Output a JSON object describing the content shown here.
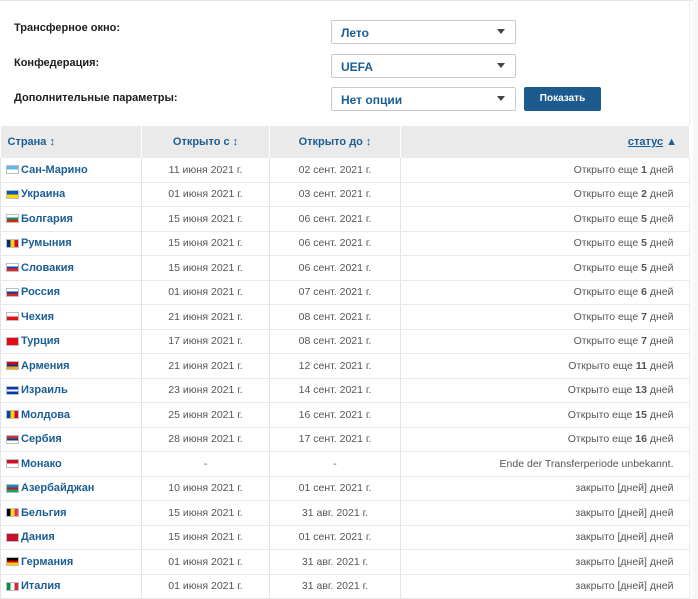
{
  "filters": {
    "transfer_window": {
      "label": "Трансферное окно:",
      "value": "Лето"
    },
    "confederation": {
      "label": "Конфедерация:",
      "value": "UEFA"
    },
    "extra": {
      "label": "Дополнительные параметры:",
      "value": "Нет опции"
    },
    "show_button": "Показать"
  },
  "table": {
    "headers": {
      "country": "Страна",
      "open_from": "Открыто с",
      "open_to": "Открыто до",
      "status": "статус"
    },
    "sort_icons": {
      "country": "↕",
      "open_from": "↕",
      "open_to": "↕",
      "status": "▲"
    },
    "rows": [
      {
        "country": "Сан-Марино",
        "flag": [
          "#5eb6e4",
          "#ffffff"
        ],
        "from": "11 июня 2021 г.",
        "to": "02 сент. 2021 г.",
        "status_pre": "Открыто еще ",
        "status_num": "1",
        "status_post": " дней",
        "state": "open"
      },
      {
        "country": "Украина",
        "flag": [
          "#0057b7",
          "#ffd700"
        ],
        "from": "01 июня 2021 г.",
        "to": "03 сент. 2021 г.",
        "status_pre": "Открыто еще ",
        "status_num": "2",
        "status_post": " дней",
        "state": "open"
      },
      {
        "country": "Болгария",
        "flag": [
          "#ffffff",
          "#00966e",
          "#d62612"
        ],
        "from": "15 июня 2021 г.",
        "to": "06 сент. 2021 г.",
        "status_pre": "Открыто еще ",
        "status_num": "5",
        "status_post": " дней",
        "state": "open"
      },
      {
        "country": "Румыния",
        "flag": [
          "#002b7f",
          "#fcd116",
          "#ce1126"
        ],
        "vertical": true,
        "from": "15 июня 2021 г.",
        "to": "06 сент. 2021 г.",
        "status_pre": "Открыто еще ",
        "status_num": "5",
        "status_post": " дней",
        "state": "open"
      },
      {
        "country": "Словакия",
        "flag": [
          "#ffffff",
          "#0b4ea2",
          "#ee1c25"
        ],
        "from": "15 июня 2021 г.",
        "to": "06 сент. 2021 г.",
        "status_pre": "Открыто еще ",
        "status_num": "5",
        "status_post": " дней",
        "state": "open"
      },
      {
        "country": "Россия",
        "flag": [
          "#ffffff",
          "#0039a6",
          "#d52b1e"
        ],
        "from": "01 июня 2021 г.",
        "to": "07 сент. 2021 г.",
        "status_pre": "Открыто еще ",
        "status_num": "6",
        "status_post": " дней",
        "state": "open"
      },
      {
        "country": "Чехия",
        "flag": [
          "#ffffff",
          "#d7141a"
        ],
        "from": "21 июня 2021 г.",
        "to": "08 сент. 2021 г.",
        "status_pre": "Открыто еще ",
        "status_num": "7",
        "status_post": " дней",
        "state": "open"
      },
      {
        "country": "Турция",
        "flag": [
          "#e30a17"
        ],
        "from": "17 июня 2021 г.",
        "to": "08 сент. 2021 г.",
        "status_pre": "Открыто еще ",
        "status_num": "7",
        "status_post": " дней",
        "state": "open"
      },
      {
        "country": "Армения",
        "flag": [
          "#d90012",
          "#0033a0",
          "#f2a800"
        ],
        "from": "21 июня 2021 г.",
        "to": "12 сент. 2021 г.",
        "status_pre": "Открыто еще ",
        "status_num": "11",
        "status_post": " дней",
        "state": "open"
      },
      {
        "country": "Израиль",
        "flag": [
          "#0038b8",
          "#ffffff",
          "#0038b8"
        ],
        "from": "23 июня 2021 г.",
        "to": "14 сент. 2021 г.",
        "status_pre": "Открыто еще ",
        "status_num": "13",
        "status_post": " дней",
        "state": "open"
      },
      {
        "country": "Молдова",
        "flag": [
          "#0046ae",
          "#ffd200",
          "#cc092f"
        ],
        "vertical": true,
        "from": "25 июня 2021 г.",
        "to": "16 сент. 2021 г.",
        "status_pre": "Открыто еще ",
        "status_num": "15",
        "status_post": " дней",
        "state": "open"
      },
      {
        "country": "Сербия",
        "flag": [
          "#c6363c",
          "#0c4076",
          "#ffffff"
        ],
        "from": "28 июня 2021 г.",
        "to": "17 сент. 2021 г.",
        "status_pre": "Открыто еще ",
        "status_num": "16",
        "status_post": " дней",
        "state": "open"
      },
      {
        "country": "Монако",
        "flag": [
          "#ce1126",
          "#ffffff"
        ],
        "from": "-",
        "to": "-",
        "status_pre": "Ende der Transferperiode unbekannt.",
        "status_num": "",
        "status_post": "",
        "state": "open"
      },
      {
        "country": "Азербайджан",
        "flag": [
          "#0092bc",
          "#e4002b",
          "#00af66"
        ],
        "from": "10 июня 2021 г.",
        "to": "01 сент. 2021 г.",
        "status_pre": "закрыто [дней] дней",
        "status_num": "",
        "status_post": "",
        "state": "closed"
      },
      {
        "country": "Бельгия",
        "flag": [
          "#000000",
          "#fdda24",
          "#ef3340"
        ],
        "vertical": true,
        "from": "15 июня 2021 г.",
        "to": "31 авг. 2021 г.",
        "status_pre": "закрыто [дней] дней",
        "status_num": "",
        "status_post": "",
        "state": "closed"
      },
      {
        "country": "Дания",
        "flag": [
          "#c8102e"
        ],
        "from": "15 июня 2021 г.",
        "to": "01 сент. 2021 г.",
        "status_pre": "закрыто [дней] дней",
        "status_num": "",
        "status_post": "",
        "state": "closed"
      },
      {
        "country": "Германия",
        "flag": [
          "#000000",
          "#dd0000",
          "#ffce00"
        ],
        "from": "01 июня 2021 г.",
        "to": "31 авг. 2021 г.",
        "status_pre": "закрыто [дней] дней",
        "status_num": "",
        "status_post": "",
        "state": "closed"
      },
      {
        "country": "Италия",
        "flag": [
          "#009246",
          "#ffffff",
          "#ce2b37"
        ],
        "vertical": true,
        "from": "01 июня 2021 г.",
        "to": "31 авг. 2021 г.",
        "status_pre": "закрыто [дней] дней",
        "status_num": "",
        "status_post": "",
        "state": "closed"
      }
    ]
  }
}
